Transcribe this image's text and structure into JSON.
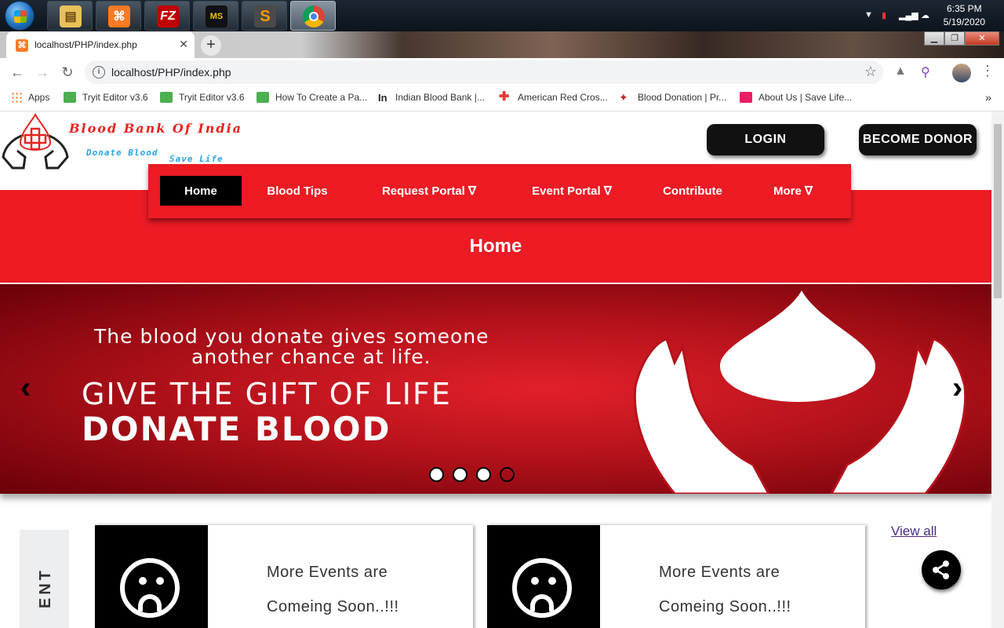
{
  "taskbar": {
    "apps": [
      {
        "name": "file-explorer",
        "glyph": "🗂"
      },
      {
        "name": "xampp",
        "glyph": "⌘"
      },
      {
        "name": "filezilla",
        "glyph": "FZ"
      },
      {
        "name": "ms-office",
        "glyph": "MS"
      },
      {
        "name": "sublime",
        "glyph": "S"
      },
      {
        "name": "chrome",
        "glyph": "●"
      }
    ],
    "time": "6:35 PM",
    "date": "5/19/2020"
  },
  "browser": {
    "tab_title": "localhost/PHP/index.php",
    "url": "localhost/PHP/index.php",
    "bookmarks": [
      {
        "label": "Apps",
        "color": "#e8710a"
      },
      {
        "label": "Tryit Editor v3.6",
        "color": "#4caf50"
      },
      {
        "label": "Tryit Editor v3.6",
        "color": "#4caf50"
      },
      {
        "label": "How To Create a Pa...",
        "color": "#4caf50"
      },
      {
        "label": "Indian Blood Bank |...",
        "color": "#222222"
      },
      {
        "label": "American Red Cros...",
        "color": "#e53935"
      },
      {
        "label": "Blood Donation | Pr...",
        "color": "#c62828"
      },
      {
        "label": "About Us | Save Life...",
        "color": "#e91e63"
      }
    ]
  },
  "site": {
    "logo_title": "Blood Bank Of India",
    "logo_sub1": "Donate Blood",
    "logo_sub2": "Save Life",
    "login_label": "LOGIN",
    "donor_label": "BECOME DONOR",
    "nav": [
      "Home",
      "Blood Tips",
      "Request Portal ∇",
      "Event Portal ∇",
      "Contribute",
      "More ∇"
    ],
    "page_heading": "Home",
    "hero": {
      "line1": "The blood you donate gives someone",
      "line2": "another chance at life.",
      "line3": "GIVE THE GIFT OF LIFE",
      "line4": "DONATE BLOOD",
      "slide_count": 4,
      "active_slide": 4
    },
    "events": {
      "side_label": "ENT",
      "cards": [
        {
          "line1": "More Events are",
          "line2": "Comeing Soon..!!!"
        },
        {
          "line1": "More Events are",
          "line2": "Comeing Soon..!!!"
        }
      ],
      "view_all": "View all"
    },
    "colors": {
      "brand_red": "#ec1b24",
      "dark": "#111111"
    }
  }
}
